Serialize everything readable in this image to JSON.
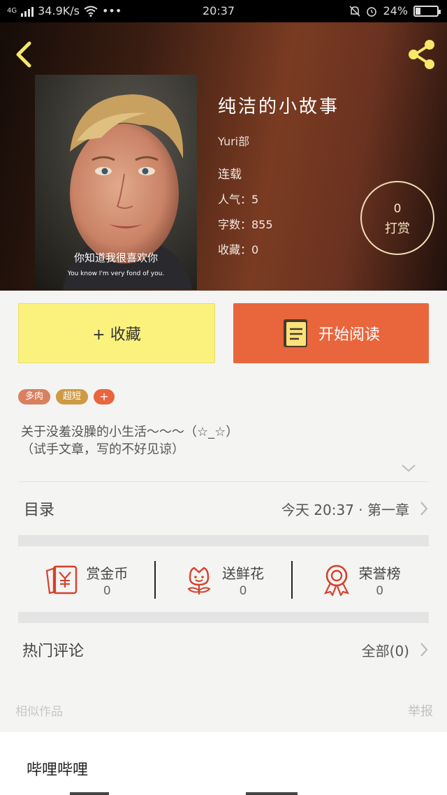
{
  "status_bar": {
    "network": "4G",
    "speed": "34.9K/s",
    "more": "•••",
    "time": "20:37",
    "battery": "24%",
    "battery_level": 0.24
  },
  "header": {
    "title": "纯洁的小故事",
    "author": "Yuri部",
    "status": "连载",
    "popularity": "人气：5",
    "word_count": "字数：855",
    "favorites": "收藏：0",
    "reward": {
      "count": "0",
      "label": "打赏"
    },
    "cover": {
      "subtitle_cn": "你知道我很喜欢你",
      "subtitle_en": "You know I'm very fond of you."
    }
  },
  "actions": {
    "collect_label": "+ 收藏",
    "read_label": "开始阅读"
  },
  "tags": [
    {
      "label": "多肉",
      "color": "#d9805f"
    },
    {
      "label": "超短",
      "color": "#cf9a44"
    }
  ],
  "tag_add": "+",
  "description": {
    "line1": "关于没羞没臊的小生活～～～（☆_☆）",
    "line2": "（试手文章，写的不好见谅）"
  },
  "toc": {
    "label": "目录",
    "latest": "今天 20:37 · 第一章"
  },
  "stats": [
    {
      "label": "赏金币",
      "value": "0",
      "icon": "red-envelope-icon"
    },
    {
      "label": "送鲜花",
      "value": "0",
      "icon": "flower-icon"
    },
    {
      "label": "荣誉榜",
      "value": "0",
      "icon": "medal-icon"
    }
  ],
  "comments": {
    "label": "热门评论",
    "all": "全部(0)"
  },
  "footer": {
    "similar": "相似作品",
    "report": "举报"
  },
  "bottom": {
    "name": "哔哩哔哩"
  },
  "colors": {
    "accent_orange": "#e9653c",
    "collect_yellow": "#fbf27d",
    "icon_red": "#d6412c"
  }
}
